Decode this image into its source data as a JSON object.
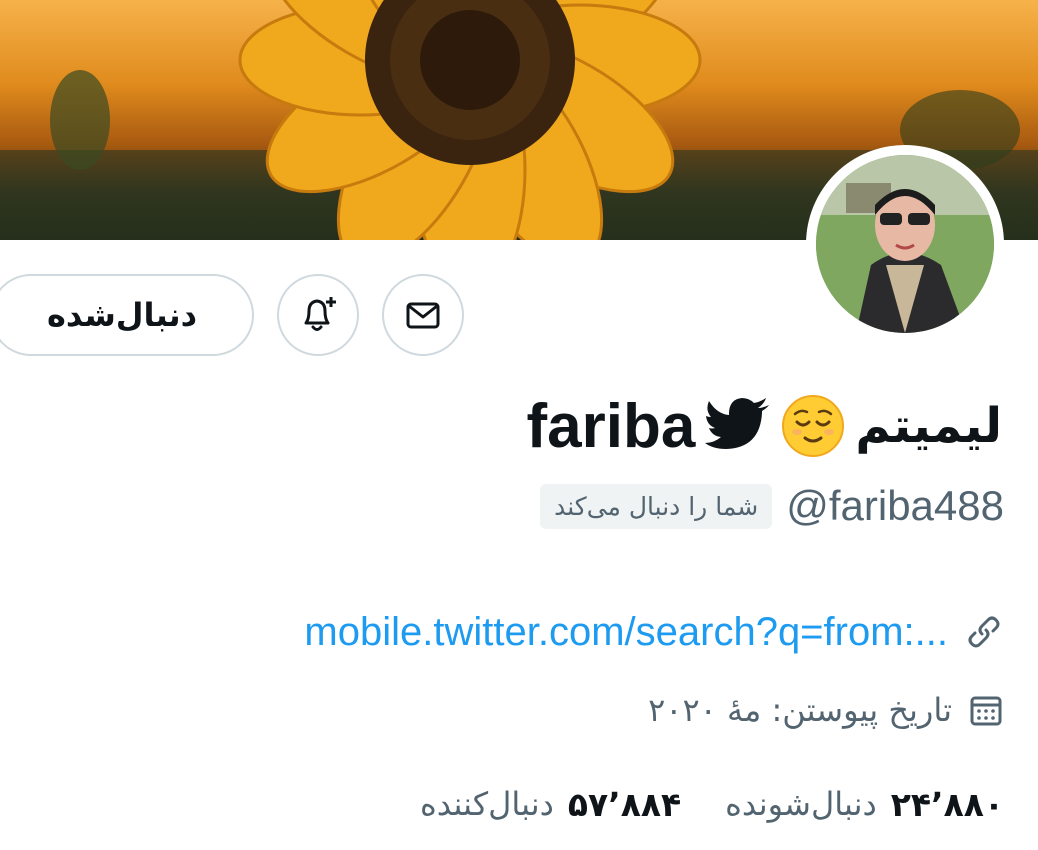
{
  "profile": {
    "display_name_fa": "لیمیتم",
    "display_name_en": "fariba",
    "handle": "@fariba488",
    "follows_you_badge": "شما را دنبال می‌کند",
    "website": "mobile.twitter.com/search?q=from:...",
    "join_date": "تاریخ پیوستن: مهٔ ۲۰۲۰"
  },
  "actions": {
    "follow_state_label": "دنبال‌شده"
  },
  "stats": {
    "following_count": "۲۴٬۸۸۰",
    "following_label": "دنبال‌شونده",
    "followers_count": "۵۷٬۸۸۴",
    "followers_label": "دنبال‌کننده"
  },
  "colors": {
    "link": "#1d9bf0",
    "secondary_text": "#536471",
    "primary_text": "#0f1419",
    "border": "#cfd9de"
  },
  "icons": [
    "envelope-icon",
    "bell-plus-icon",
    "twitter-bird-icon",
    "relieved-face-emoji",
    "link-icon",
    "calendar-icon"
  ]
}
